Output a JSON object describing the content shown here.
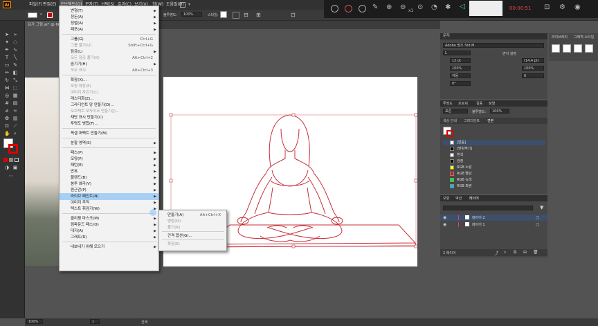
{
  "menubar": {
    "logo": "Ai",
    "items": [
      "파일(F)",
      "편집(E)",
      "오브젝트(O)",
      "문자(T)",
      "선택(S)",
      "효과(C)",
      "보기(V)",
      "창(W)",
      "도움말(H)"
    ]
  },
  "controlbar": {
    "style_label": "불투명도:",
    "opacity_value": "100%",
    "style2_label": "스타일:"
  },
  "doctab": {
    "label": "요가 그림.ai* @ 66.67% (RGB/GPU 미리 보기)"
  },
  "object_menu": {
    "items": [
      {
        "label": "변형(T)",
        "shortcut": "",
        "arrow": true,
        "disabled": false
      },
      {
        "label": "정돈(A)",
        "shortcut": "",
        "arrow": true,
        "disabled": false
      },
      {
        "label": "정렬(A)",
        "shortcut": "",
        "arrow": true,
        "disabled": false
      },
      {
        "label": "패포(A)",
        "shortcut": "",
        "arrow": true,
        "disabled": false
      },
      {
        "sep": true
      },
      {
        "label": "그룹(G)",
        "shortcut": "Ctrl+G",
        "arrow": false,
        "disabled": false
      },
      {
        "label": "그룹 풀기(U)",
        "shortcut": "Shift+Ctrl+G",
        "arrow": false,
        "disabled": true
      },
      {
        "label": "잠금(L)",
        "shortcut": "",
        "arrow": true,
        "disabled": false
      },
      {
        "label": "모든 잠금 풀기(K)",
        "shortcut": "Alt+Ctrl+2",
        "arrow": false,
        "disabled": true
      },
      {
        "label": "숨기기(H)",
        "shortcut": "",
        "arrow": true,
        "disabled": false
      },
      {
        "label": "모두 표시",
        "shortcut": "Alt+Ctrl+3",
        "arrow": false,
        "disabled": true
      },
      {
        "sep": true
      },
      {
        "label": "확장(X)...",
        "shortcut": "",
        "arrow": false,
        "disabled": false
      },
      {
        "label": "모양 확장(E)",
        "shortcut": "",
        "arrow": false,
        "disabled": true
      },
      {
        "label": "이미지 자르기(C)",
        "shortcut": "",
        "arrow": false,
        "disabled": true
      },
      {
        "label": "래스터화(Z)...",
        "shortcut": "",
        "arrow": false,
        "disabled": false
      },
      {
        "label": "그라디언트 망 만들기(D)...",
        "shortcut": "",
        "arrow": false,
        "disabled": false
      },
      {
        "label": "오브젝트 모자이크 만들기(J)...",
        "shortcut": "",
        "arrow": false,
        "disabled": true
      },
      {
        "label": "재단 표시 만들기(C)",
        "shortcut": "",
        "arrow": false,
        "disabled": false
      },
      {
        "label": "투명도 병합(F)...",
        "shortcut": "",
        "arrow": false,
        "disabled": false
      },
      {
        "sep": true
      },
      {
        "label": "픽셀 퍼펙트 만들기(M)",
        "shortcut": "",
        "arrow": false,
        "disabled": false
      },
      {
        "sep": true
      },
      {
        "label": "분할 영역(S)",
        "shortcut": "",
        "arrow": true,
        "disabled": false
      },
      {
        "sep": true
      },
      {
        "label": "패스(P)",
        "shortcut": "",
        "arrow": true,
        "disabled": false
      },
      {
        "label": "모양(P)",
        "shortcut": "",
        "arrow": true,
        "disabled": false
      },
      {
        "label": "패턴(E)",
        "shortcut": "",
        "arrow": true,
        "disabled": false
      },
      {
        "label": "반복",
        "shortcut": "",
        "arrow": true,
        "disabled": false
      },
      {
        "label": "블렌드(B)",
        "shortcut": "",
        "arrow": true,
        "disabled": false
      },
      {
        "label": "봉투 왜곡(V)",
        "shortcut": "",
        "arrow": true,
        "disabled": false
      },
      {
        "label": "원근감(P)",
        "shortcut": "",
        "arrow": true,
        "disabled": false
      },
      {
        "label": "라이브 페인트(N)",
        "shortcut": "",
        "arrow": true,
        "disabled": false,
        "highlight": true
      },
      {
        "label": "이미지 추적",
        "shortcut": "",
        "arrow": true,
        "disabled": false
      },
      {
        "label": "텍스트 휘감기(W)",
        "shortcut": "",
        "arrow": true,
        "disabled": false
      },
      {
        "sep": true
      },
      {
        "label": "클리핑 마스크(M)",
        "shortcut": "",
        "arrow": true,
        "disabled": false
      },
      {
        "label": "컴파운드 패스(O)",
        "shortcut": "",
        "arrow": true,
        "disabled": false
      },
      {
        "label": "대지(A)",
        "shortcut": "",
        "arrow": true,
        "disabled": false
      },
      {
        "label": "그래프(R)",
        "shortcut": "",
        "arrow": true,
        "disabled": false
      },
      {
        "sep": true
      },
      {
        "label": "내보내기 위해 모으기",
        "shortcut": "",
        "arrow": true,
        "disabled": false
      }
    ]
  },
  "sub_menu": {
    "items": [
      {
        "label": "만들기(A)",
        "shortcut": "Alt+Ctrl+X",
        "disabled": false
      },
      {
        "label": "병합(M)",
        "shortcut": "",
        "disabled": true
      },
      {
        "label": "풀기(R)",
        "shortcut": "",
        "disabled": true
      },
      {
        "sep": true
      },
      {
        "label": "간격 옵션(G)...",
        "shortcut": "",
        "disabled": false
      },
      {
        "sep": true
      },
      {
        "label": "확장(E)",
        "shortcut": "",
        "disabled": true
      }
    ]
  },
  "recorder": {
    "time": "00:00:51",
    "zoom": "x1"
  },
  "char_panel": {
    "title": "문자",
    "font": "Adobe 명조 Std M",
    "style": "L",
    "font_size": "12 pt",
    "leading": "(14.4 pt)",
    "tracking": "100%",
    "scale_v": "100%",
    "kerning": "자동",
    "baseline": "0",
    "rotation": "0°",
    "side_label": "변지 설정"
  },
  "swatch_panel": {
    "tabs": [
      "투명도",
      "프로세",
      "길동",
      "정렬"
    ],
    "mode_label": "표준",
    "opacity_label": "불투명도:",
    "opacity_value": "100%",
    "tabs2": [
      "색상 안내",
      "그라디언트",
      "견본"
    ],
    "swatches": [
      {
        "label": "[없음]",
        "color": "#ffffff"
      },
      {
        "label": "[맞춰찍기]",
        "color": "#000000"
      },
      {
        "label": "흰색",
        "color": "#ffffff"
      },
      {
        "label": "검정",
        "color": "#000000"
      },
      {
        "label": "RGB 노랑",
        "color": "#ffff00"
      },
      {
        "label": "RGB 빨강",
        "color": "#ff0000"
      },
      {
        "label": "RGB 녹색",
        "color": "#00ff00"
      },
      {
        "label": "RGB 파랑",
        "color": "#00c0ff"
      }
    ]
  },
  "layer_panel": {
    "tabs": [
      "모양",
      "액션",
      "레이어"
    ],
    "layers": [
      "레이어 2",
      "레이어 1"
    ],
    "count_label": "2 레이어"
  },
  "side_dock": {
    "tabs": [
      "라이브러리",
      "그래픽 스타일"
    ]
  },
  "status": {
    "zoom": "100%",
    "page": "1",
    "tool": "선택"
  }
}
